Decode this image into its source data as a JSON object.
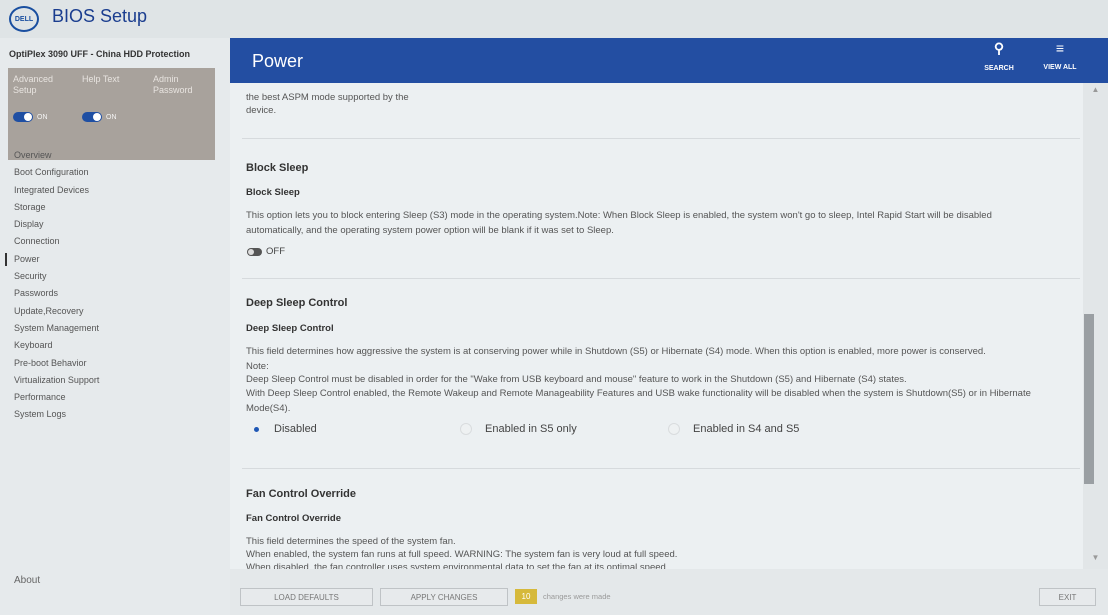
{
  "app": {
    "logo": "DELL",
    "title": "BIOS Setup"
  },
  "sidebar": {
    "model": "OptiPlex 3090 UFF - China HDD Protection",
    "advanced_setup": {
      "label": "Advanced Setup",
      "state": "ON"
    },
    "help_text": {
      "label": "Help Text",
      "state": "ON"
    },
    "admin_password": {
      "label": "Admin Password"
    },
    "items": [
      {
        "label": "Overview"
      },
      {
        "label": "Boot Configuration"
      },
      {
        "label": "Integrated Devices"
      },
      {
        "label": "Storage"
      },
      {
        "label": "Display"
      },
      {
        "label": "Connection"
      },
      {
        "label": "Power"
      },
      {
        "label": "Security"
      },
      {
        "label": "Passwords"
      },
      {
        "label": "Update,Recovery"
      },
      {
        "label": "System Management"
      },
      {
        "label": "Keyboard"
      },
      {
        "label": "Pre-boot Behavior"
      },
      {
        "label": "Virtualization Support"
      },
      {
        "label": "Performance"
      },
      {
        "label": "System Logs"
      }
    ],
    "active_item": "Power",
    "about": "About"
  },
  "header": {
    "title": "Power",
    "search": {
      "label": "SEARCH",
      "icon": "search-icon"
    },
    "view_all": {
      "label": "VIEW ALL",
      "icon": "filter-icon"
    }
  },
  "content": {
    "aspm_cut_text": "the best ASPM mode supported by the",
    "aspm_cut_text2": "device.",
    "block_sleep": {
      "section": "Block Sleep",
      "title": "Block Sleep",
      "desc1": "This option lets you to block entering Sleep (S3) mode in the operating system.Note: When Block Sleep is enabled, the system won't go to sleep, Intel Rapid Start will be disabled",
      "desc2": "automatically, and the operating system power option will be blank if it was set to Sleep.",
      "state": "OFF"
    },
    "deep_sleep": {
      "section": "Deep Sleep Control",
      "title": "Deep Sleep Control",
      "desc1": "This field determines how aggressive the system is at conserving power while in Shutdown (S5) or Hibernate (S4) mode.  When this option is enabled, more power is conserved.",
      "desc2": "Note:",
      "desc3": "Deep Sleep Control must be disabled in order for the \"Wake from USB keyboard and mouse\" feature to work in the Shutdown (S5) and Hibernate (S4) states.",
      "desc4": "With Deep Sleep Control enabled, the Remote Wakeup and Remote Manageability Features and USB wake functionality will be disabled when the system is Shutdown(S5) or in Hibernate",
      "desc5": "Mode(S4).",
      "options": [
        "Disabled",
        "Enabled in S5 only",
        "Enabled in S4 and S5"
      ],
      "selected": "Disabled"
    },
    "fan_control": {
      "section": "Fan Control Override",
      "title": "Fan Control Override",
      "desc1": "This field determines the speed of the system fan.",
      "desc2": "When enabled, the system fan runs at full speed. WARNING: The system fan is very loud at full speed.",
      "desc3": "When disabled, the fan controller uses system environmental data to set the fan at its optimal speed."
    }
  },
  "footer": {
    "load_defaults": "LOAD DEFAULTS",
    "apply_changes": "APPLY CHANGES",
    "changes_count": "10",
    "changes_note": "changes were made",
    "exit": "EXIT"
  },
  "colors": {
    "header_blue": "#234ea2",
    "toggle_blue": "#1f4fa3",
    "badge": "#d6b93b"
  }
}
